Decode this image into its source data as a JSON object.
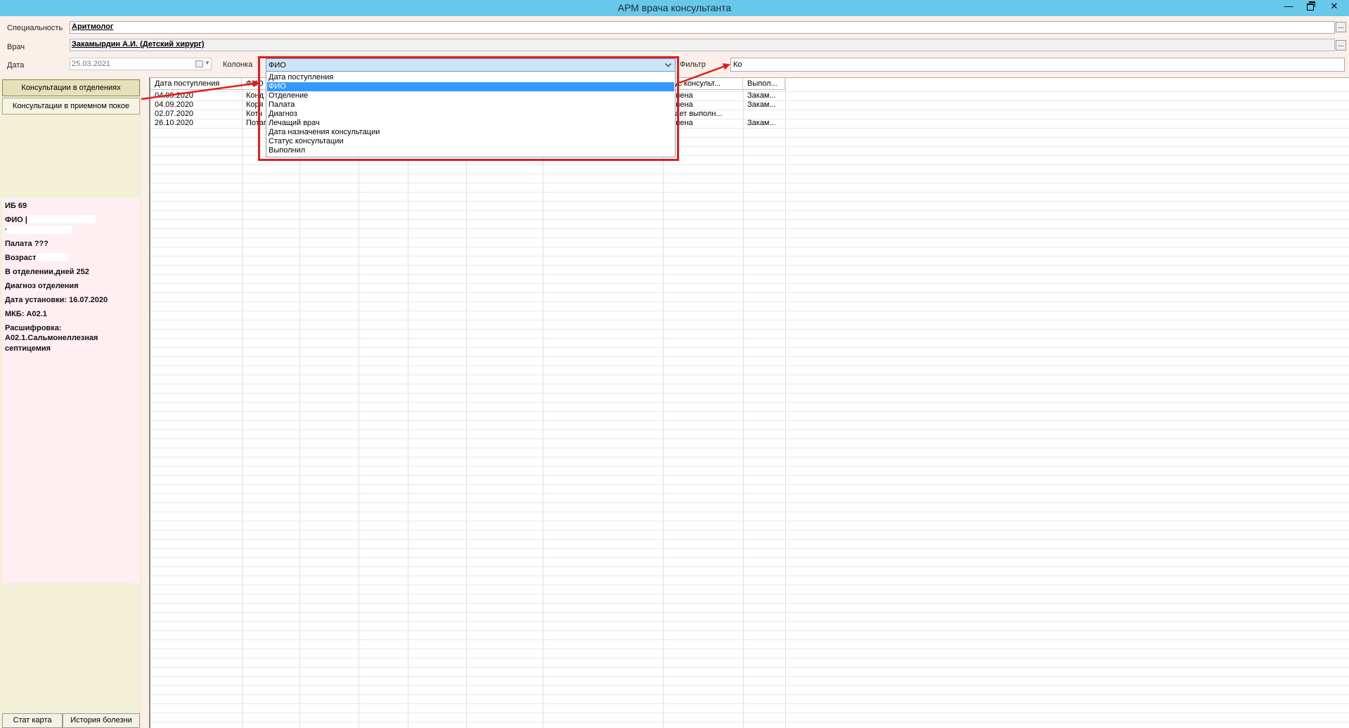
{
  "window": {
    "title": "АРМ врача консультанта",
    "minimize_glyph": "—",
    "close_glyph": "✕"
  },
  "form": {
    "specialty_label": "Специальность",
    "specialty_value": "Аритмолог",
    "doctor_label": "Врач",
    "doctor_value": "Закамырдин А.И. (Детский хирург)",
    "date_label": "Дата",
    "date_value": "25.03.2021",
    "column_label": "Колонка",
    "column_value": "ФИО",
    "filter_label": "Фильтр",
    "filter_value": "Ко",
    "browse_glyph": "..."
  },
  "dropdown_options": [
    "Дата поступления",
    "ФИО",
    "Отделение",
    "Палата",
    "Диагноз",
    "Лечащий врач",
    "Дата назначения консультации",
    "Статус консультации",
    "Выполнил"
  ],
  "dropdown_selected": "ФИО",
  "nav": {
    "departments": "Консультации в отделениях",
    "reception": "Консультации в приемном покое"
  },
  "patient": {
    "ib": "ИБ 69",
    "fio": "ФИО |",
    "dot": ".",
    "ward": "Палата ???",
    "age": "Возраст",
    "days": "В отделении,дней 252",
    "dept_diag": "Диагноз отделения",
    "set_date": "Дата установки: 16.07.2020",
    "mkb": "МКБ: A02.1",
    "decode_label": "Расшифровка:",
    "decode_value": "A02.1.Сальмонеллезная септицемия"
  },
  "bottom": {
    "stat_card": "Стат карта",
    "history": "История болезни"
  },
  "grid": {
    "headers": [
      "Дата поступления",
      "ФИО",
      "татус консульт...",
      "Выпол..."
    ],
    "rows": [
      {
        "date": "04.09.2020",
        "fio": "Конд",
        "status": "полнена",
        "done": "Закам..."
      },
      {
        "date": "04.09.2020",
        "fio": "Коря",
        "status": "полнена",
        "done": "Закам..."
      },
      {
        "date": "02.07.2020",
        "fio": "Котч",
        "status": "кидает выполн...",
        "done": ""
      },
      {
        "date": "26.10.2020",
        "fio": "Потап",
        "status": "полнена",
        "done": "Закам..."
      }
    ]
  },
  "colors": {
    "titlebar": "#68c8ea",
    "highlight": "#e41c1c",
    "selection": "#3399ff",
    "sidebar": "#f2f0d6",
    "info_panel": "#ffeef2"
  }
}
